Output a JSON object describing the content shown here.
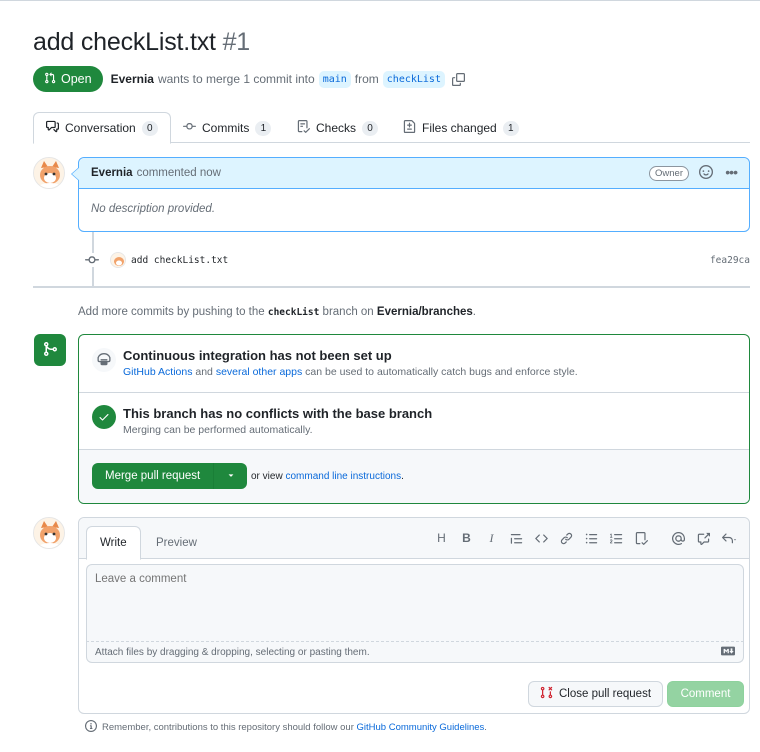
{
  "pr": {
    "title": "add checkList.txt",
    "number": "#1",
    "state": "Open",
    "author": "Evernia",
    "merge_text": "wants to merge 1 commit into",
    "base_branch": "main",
    "from_text": "from",
    "head_branch": "checkList"
  },
  "tabs": [
    {
      "label": "Conversation",
      "count": "0"
    },
    {
      "label": "Commits",
      "count": "1"
    },
    {
      "label": "Checks",
      "count": "0"
    },
    {
      "label": "Files changed",
      "count": "1"
    }
  ],
  "comment": {
    "author": "Evernia",
    "meta": "commented now",
    "role": "Owner",
    "body": "No description provided."
  },
  "commit": {
    "message": "add checkList.txt",
    "sha": "fea29ca"
  },
  "push_note": {
    "prefix": "Add more commits by pushing to the",
    "branch": "checkList",
    "middle": "branch on",
    "repo": "Evernia/branches",
    "suffix": "."
  },
  "merge": {
    "ci_title": "Continuous integration has not been set up",
    "ci_link1": "GitHub Actions",
    "ci_and": "and",
    "ci_link2": "several other apps",
    "ci_rest": "can be used to automatically catch bugs and enforce style.",
    "conflict_title": "This branch has no conflicts with the base branch",
    "conflict_sub": "Merging can be performed automatically.",
    "merge_button": "Merge pull request",
    "or_view": "or view",
    "cli_link": "command line instructions",
    "cli_suffix": "."
  },
  "editor": {
    "tab_write": "Write",
    "tab_preview": "Preview",
    "placeholder": "Leave a comment",
    "attach_text": "Attach files by dragging & dropping, selecting or pasting them.",
    "close_button": "Close pull request",
    "comment_button": "Comment"
  },
  "footer": {
    "text": "Remember, contributions to this repository should follow our",
    "link": "GitHub Community Guidelines",
    "suffix": "."
  },
  "colors": {
    "green": "#1f883d",
    "blue_link": "#0969da",
    "comment_header": "#ddf4ff",
    "close_icon_red": "#cf222e"
  }
}
